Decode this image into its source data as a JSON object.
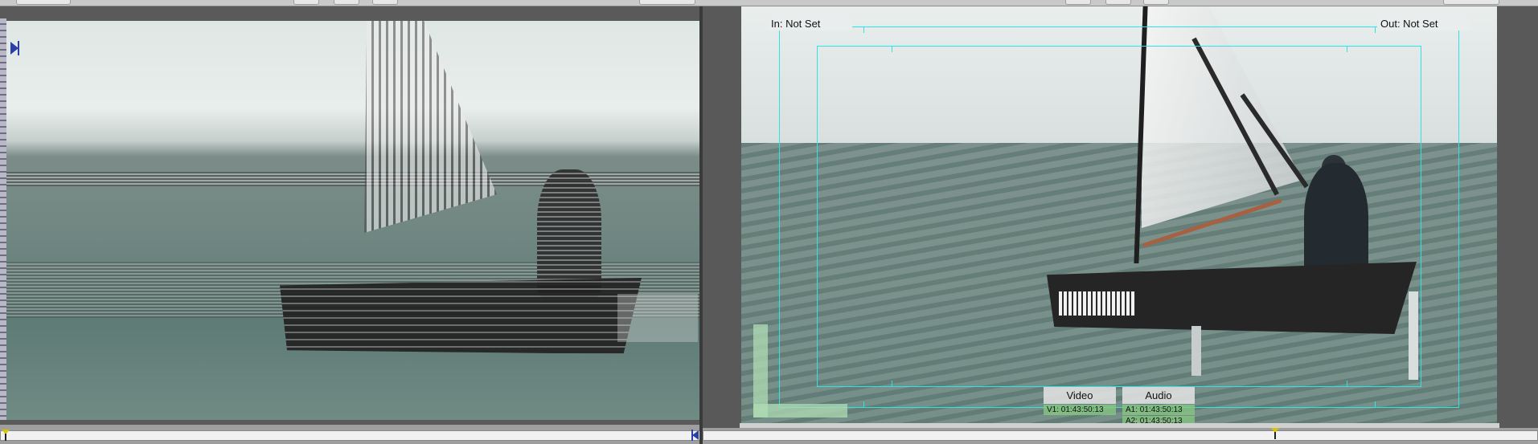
{
  "viewer": {
    "in_label": "In: Not Set",
    "out_label": "Out: Not Set"
  },
  "timecode_overlay": {
    "video": {
      "title": "Video",
      "lines": [
        "V1: 01:43:50:13"
      ]
    },
    "audio": {
      "title": "Audio",
      "lines": [
        "A1: 01:43:50:13",
        "A2: 01:43:50:13"
      ]
    }
  },
  "colors": {
    "safe_area": "#2fe3e3",
    "timecode_badge": "#87c882",
    "marker": "#2a3fa8"
  },
  "icons": {
    "in_point_marker": "in-point-marker-icon",
    "playhead": "playhead-icon",
    "out_point_marker": "out-point-marker-icon"
  }
}
